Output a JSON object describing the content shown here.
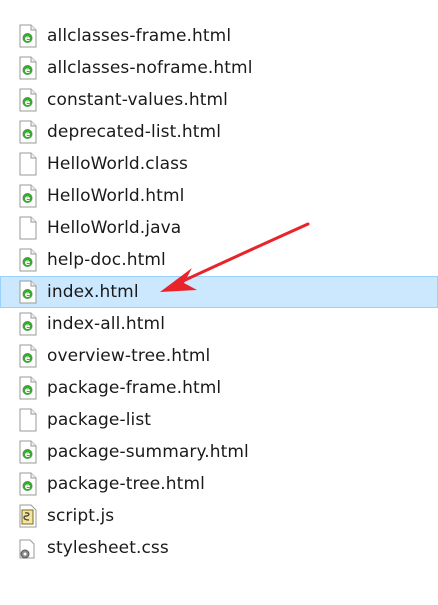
{
  "files": [
    {
      "name": "allclasses-frame.html",
      "icon": "html-file-icon",
      "selected": false
    },
    {
      "name": "allclasses-noframe.html",
      "icon": "html-file-icon",
      "selected": false
    },
    {
      "name": "constant-values.html",
      "icon": "html-file-icon",
      "selected": false
    },
    {
      "name": "deprecated-list.html",
      "icon": "html-file-icon",
      "selected": false
    },
    {
      "name": "HelloWorld.class",
      "icon": "generic-file-icon",
      "selected": false
    },
    {
      "name": "HelloWorld.html",
      "icon": "html-file-icon",
      "selected": false
    },
    {
      "name": "HelloWorld.java",
      "icon": "generic-file-icon",
      "selected": false
    },
    {
      "name": "help-doc.html",
      "icon": "html-file-icon",
      "selected": false
    },
    {
      "name": "index.html",
      "icon": "html-file-icon",
      "selected": true
    },
    {
      "name": "index-all.html",
      "icon": "html-file-icon",
      "selected": false
    },
    {
      "name": "overview-tree.html",
      "icon": "html-file-icon",
      "selected": false
    },
    {
      "name": "package-frame.html",
      "icon": "html-file-icon",
      "selected": false
    },
    {
      "name": "package-list",
      "icon": "generic-file-icon",
      "selected": false
    },
    {
      "name": "package-summary.html",
      "icon": "html-file-icon",
      "selected": false
    },
    {
      "name": "package-tree.html",
      "icon": "html-file-icon",
      "selected": false
    },
    {
      "name": "script.js",
      "icon": "script-file-icon",
      "selected": false
    },
    {
      "name": "stylesheet.css",
      "icon": "css-file-icon",
      "selected": false
    }
  ],
  "colors": {
    "selection_bg": "#cce8ff",
    "selection_border": "#99d1ff",
    "arrow": "#e8232a",
    "html_icon_accent": "#3fa535"
  }
}
